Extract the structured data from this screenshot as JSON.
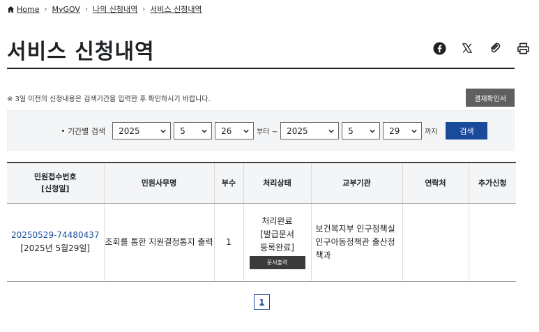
{
  "breadcrumb": {
    "items": [
      "Home",
      "MyGOV",
      "나의 신청내역",
      "서비스 신청내역"
    ]
  },
  "page": {
    "title": "서비스 신청내역"
  },
  "share_tools": [
    "facebook-icon",
    "x-icon",
    "link-icon",
    "print-icon"
  ],
  "notice": {
    "text": "※ 3일 이전의 신청내용은 검색기간을 입력한 후 확인하시기 바랍니다.",
    "approve_button": "결재확인서"
  },
  "search": {
    "label": "기간별 검색",
    "from": {
      "year": "2025",
      "month": "5",
      "day": "26"
    },
    "from_suffix": "부터 ~",
    "to": {
      "year": "2025",
      "month": "5",
      "day": "29"
    },
    "to_suffix": "까지",
    "button": "검색"
  },
  "table": {
    "headers": {
      "receipt": "민원접수번호",
      "receipt_sub": "[신청일]",
      "service": "민원사무명",
      "copies": "부수",
      "status": "처리상태",
      "agency": "교부기관",
      "contact": "연락처",
      "extra": "추가신청"
    },
    "rows": [
      {
        "receipt_no": "20250529-74480437",
        "date": "[2025년 5월29일]",
        "service": "조회를 통한 지원결정통지 출력",
        "copies": "1",
        "status_1": "처리완료",
        "status_2": "[발급문서",
        "status_3": "등록완료]",
        "print_button": "문서출력",
        "agency": "보건복지부 인구정책실 인구아동정책관 출산정책과",
        "contact": "",
        "extra": ""
      }
    ]
  },
  "pagination": {
    "current": "1"
  },
  "colors": {
    "primary": "#1a4b9b",
    "dark_button": "#5f5f5f",
    "print_button": "#3b3b3b"
  }
}
